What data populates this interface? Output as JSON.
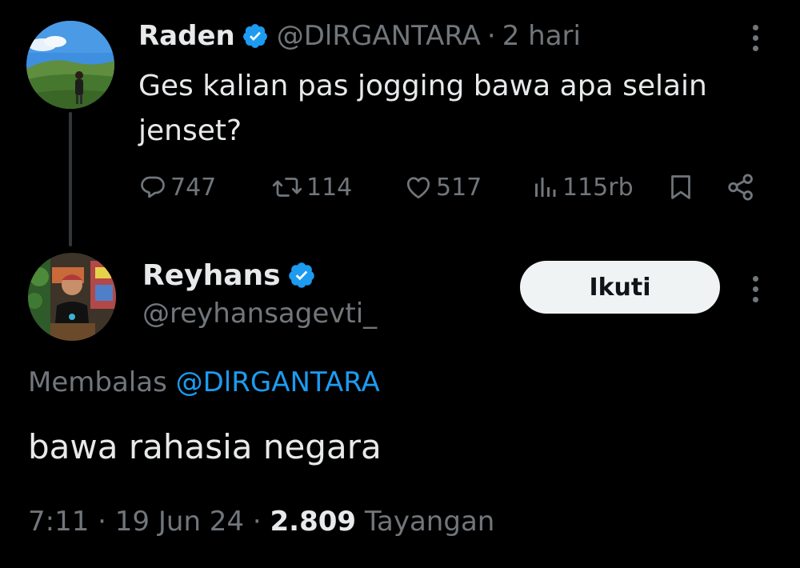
{
  "colors": {
    "background": "#000000",
    "text_primary": "#e7e9ea",
    "text_muted": "#71767b",
    "accent": "#1d9bf0",
    "follow_button_bg": "#eff3f4"
  },
  "original_tweet": {
    "author_name": "Raden",
    "verified": true,
    "handle": "@DlRGANTARA",
    "separator": "·",
    "time_ago": "2 hari",
    "text": "Ges kalian pas jogging bawa apa selain jenset?",
    "actions": {
      "replies": "747",
      "retweets": "114",
      "likes": "517",
      "views": "115rb"
    },
    "icons": [
      "more-icon",
      "reply-icon",
      "retweet-icon",
      "like-icon",
      "views-icon",
      "bookmark-icon",
      "share-icon"
    ]
  },
  "reply_tweet": {
    "author_name": "Reyhans",
    "verified": true,
    "handle": "@reyhansagevti_",
    "follow_label": "Ikuti",
    "replying_to_label": "Membalas",
    "replying_to_handle": "@DlRGANTARA",
    "text": "bawa rahasia negara",
    "time": "7:11",
    "date": "19 Jun 24",
    "separator": "·",
    "views_count": "2.809",
    "views_label": "Tayangan"
  }
}
